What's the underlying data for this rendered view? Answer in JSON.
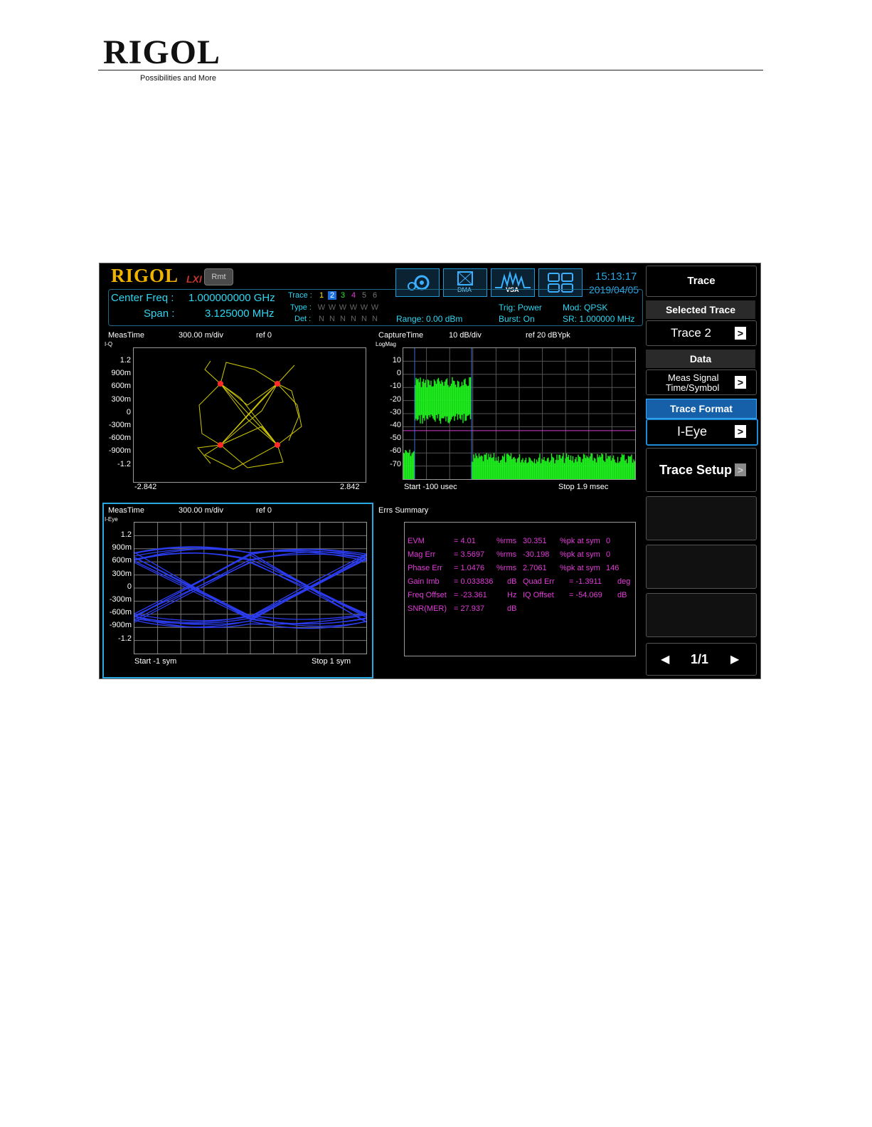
{
  "doc_header": {
    "brand": "RIGOL",
    "tagline": "Possibilities and More"
  },
  "status": {
    "logo": "RIGOL",
    "lxi": "LXI",
    "rmt": "Rmt",
    "center_freq_label": "Center Freq :",
    "center_freq_value": "1.000000000 GHz",
    "span_label": "Span :",
    "span_value": "3.125000 MHz",
    "trace_label": "Trace :",
    "type_label": "Type :",
    "det_label": "Det :",
    "trace_numbers": [
      "1",
      "2",
      "3",
      "4",
      "5",
      "6"
    ],
    "trace_colors": [
      "#f5e400",
      "#3a7bff",
      "#2ee62e",
      "#e23cd8",
      "#777777",
      "#777777"
    ],
    "type_values": [
      "W",
      "W",
      "W",
      "W",
      "W",
      "W"
    ],
    "det_values": [
      "N",
      "N",
      "N",
      "N",
      "N",
      "N"
    ],
    "range": "Range: 0.00 dBm",
    "trig": "Trig: Power",
    "burst": "Burst: On",
    "mod": "Mod: QPSK",
    "sr": "SR: 1.000000 MHz",
    "time": "15:13:17",
    "date": "2019/04/05",
    "toolbar_icons": [
      "gear-icon",
      "dma-icon",
      "vsa-icon",
      "layout-icon"
    ],
    "dma_label": "DMA",
    "vsa_label": "VSA"
  },
  "panels": {
    "iq": {
      "title": "MeasTime",
      "scale": "300.00 m/div",
      "ref": "ref 0",
      "format": "I-Q",
      "yticks": [
        "1.2",
        "900m",
        "600m",
        "300m",
        "0",
        "-300m",
        "-600m",
        "-900m",
        "-1.2"
      ],
      "start": "-2.842",
      "stop": "2.842"
    },
    "spec": {
      "title": "CaptureTime",
      "scale": "10 dB/div",
      "ref": "ref 20 dBYpk",
      "format": "LogMag",
      "yticks": [
        "10",
        "0",
        "-10",
        "-20",
        "-30",
        "-40",
        "-50",
        "-60",
        "-70"
      ],
      "start": "Start -100 usec",
      "stop": "Stop 1.9 msec"
    },
    "eye": {
      "title": "MeasTime",
      "scale": "300.00 m/div",
      "ref": "ref 0",
      "format": "I-Eye",
      "yticks": [
        "1.2",
        "900m",
        "600m",
        "300m",
        "0",
        "-300m",
        "-600m",
        "-900m",
        "-1.2"
      ],
      "start": "Start -1 sym",
      "stop": "Stop 1 sym"
    },
    "errs": {
      "title": "Errs Summary",
      "rows": [
        [
          "EVM",
          "= 4.01",
          "%rms",
          "30.351",
          "%pk at sym",
          "0"
        ],
        [
          "Mag Err",
          "= 3.5697",
          "%rms",
          "-30.198",
          "%pk at sym",
          "0"
        ],
        [
          "Phase Err",
          "= 1.0476",
          "%rms",
          "2.7061",
          "%pk at sym",
          "146"
        ],
        [
          "Gain Imb",
          "= 0.033836",
          "dB",
          "Quad Err",
          "= -1.3911",
          "deg"
        ],
        [
          "Freq Offset",
          "= -23.361",
          "Hz",
          "IQ Offset",
          "= -54.069",
          "dB"
        ],
        [
          "SNR(MER)",
          "= 27.937",
          "dB",
          "",
          "",
          ""
        ]
      ]
    }
  },
  "menu": {
    "title": "Trace",
    "selected_trace_label": "Selected Trace",
    "selected_trace_value": "Trace 2",
    "data_label": "Data",
    "data_value_line1": "Meas Signal",
    "data_value_line2": "Time/Symbol",
    "trace_format_label": "Trace Format",
    "trace_format_value": "I-Eye",
    "trace_setup_label": "Trace Setup",
    "page": "1/1"
  }
}
